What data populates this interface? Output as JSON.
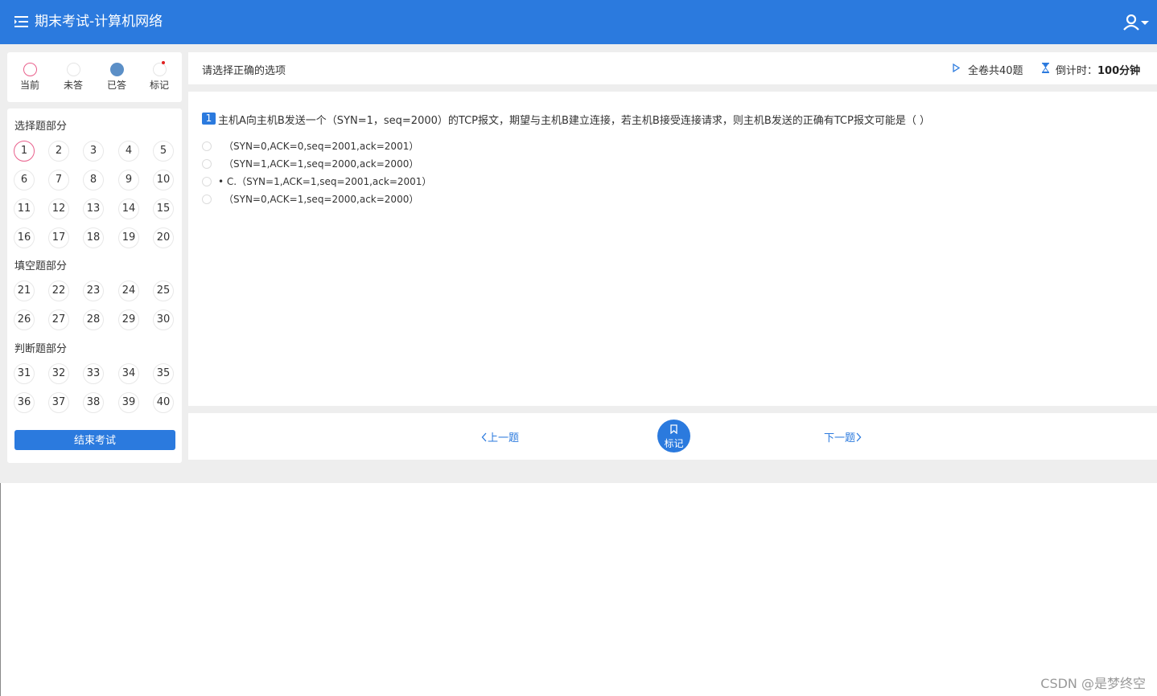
{
  "header": {
    "title": "期末考试-计算机网络",
    "menu_icon": "menu-icon",
    "user_icon": "user-icon"
  },
  "legend": [
    {
      "label": "当前",
      "state": "current"
    },
    {
      "label": "未答",
      "state": "unanswered"
    },
    {
      "label": "已答",
      "state": "answered"
    },
    {
      "label": "标记",
      "state": "flagged"
    }
  ],
  "sections": [
    {
      "title": "选择题部分",
      "questions": [
        "1",
        "2",
        "3",
        "4",
        "5",
        "6",
        "7",
        "8",
        "9",
        "10",
        "11",
        "12",
        "13",
        "14",
        "15",
        "16",
        "17",
        "18",
        "19",
        "20"
      ]
    },
    {
      "title": "填空题部分",
      "questions": [
        "21",
        "22",
        "23",
        "24",
        "25",
        "26",
        "27",
        "28",
        "29",
        "30"
      ]
    },
    {
      "title": "判断题部分",
      "questions": [
        "31",
        "32",
        "33",
        "34",
        "35",
        "36",
        "37",
        "38",
        "39",
        "40"
      ]
    }
  ],
  "current_question": "1",
  "end_exam_label": "结束考试",
  "hint": "请选择正确的选项",
  "total": "全卷共40题",
  "timer_label": "倒计时：",
  "timer_value": "100分钟",
  "question": {
    "number": "1",
    "text": "主机A向主机B发送一个（SYN=1，seq=2000）的TCP报文，期望与主机B建立连接，若主机B接受连接请求，则主机B发送的正确有TCP报文可能是（ ）",
    "options": [
      {
        "text": "（SYN=0,ACK=0,seq=2001,ack=2001）"
      },
      {
        "text": "（SYN=1,ACK=1,seq=2000,ack=2000）"
      },
      {
        "text": "• C.（SYN=1,ACK=1,seq=2001,ack=2001）"
      },
      {
        "text": "（SYN=0,ACK=1,seq=2000,ack=2000）"
      }
    ]
  },
  "nav": {
    "prev": "上一题",
    "flag": "标记",
    "next": "下一题"
  },
  "watermark": "CSDN @是梦终空",
  "colors": {
    "accent": "#2b7ade",
    "current_ring": "#e9608c",
    "answered": "#5b8fc7",
    "flag_dot": "#e02020"
  }
}
